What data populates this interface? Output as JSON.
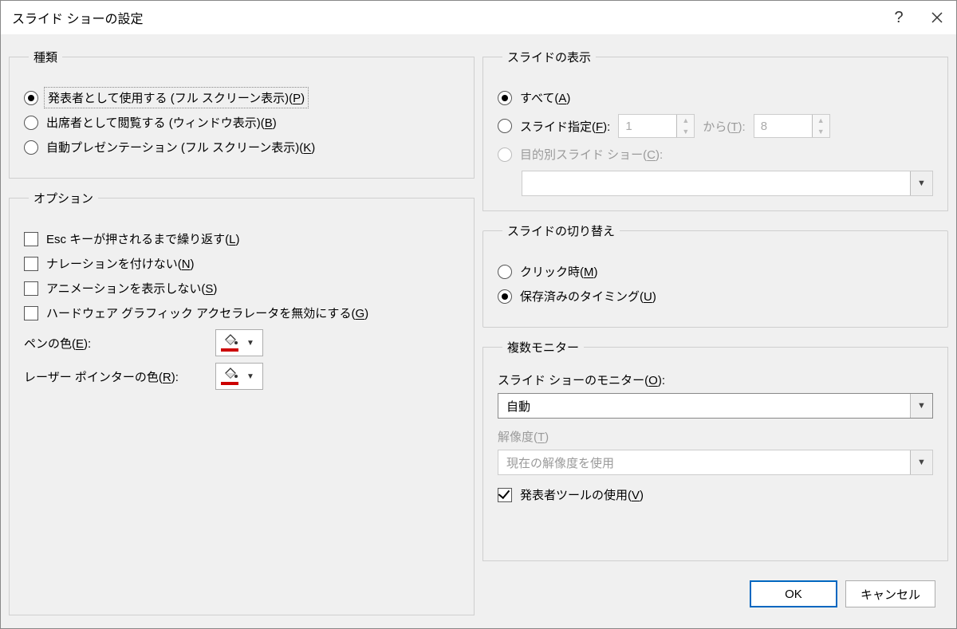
{
  "title": "スライド ショーの設定",
  "groups": {
    "type": {
      "legend": "種類",
      "opt_presenter": "発表者として使用する (フル スクリーン表示)(",
      "opt_presenter_key": "P",
      "opt_browse": "出席者として閲覧する (ウィンドウ表示)(",
      "opt_browse_key": "B",
      "opt_kiosk": "自動プレゼンテーション (フル スクリーン表示)(",
      "opt_kiosk_key": "K",
      "close_paren": ")"
    },
    "options": {
      "legend": "オプション",
      "loop": "Esc キーが押されるまで繰り返す(",
      "loop_key": "L",
      "nonarr": "ナレーションを付けない(",
      "nonarr_key": "N",
      "noanim": "アニメーションを表示しない(",
      "noanim_key": "S",
      "nohw": "ハードウェア グラフィック アクセラレータを無効にする(",
      "nohw_key": "G",
      "pencolor_label": "ペンの色(",
      "pencolor_key": "E",
      "lasercolor_label": "レーザー ポインターの色(",
      "lasercolor_key": "R",
      "close_paren": ")",
      "colon": ":"
    },
    "show_slides": {
      "legend": "スライドの表示",
      "all": "すべて(",
      "all_key": "A",
      "range": "スライド指定(",
      "range_key": "F",
      "from_val": "1",
      "to_label": "から(",
      "to_key": "T",
      "to_val": "8",
      "custom": "目的別スライド ショー(",
      "custom_key": "C",
      "close_paren": ")",
      "colon": ":"
    },
    "advance": {
      "legend": "スライドの切り替え",
      "manual": "クリック時(",
      "manual_key": "M",
      "timings": "保存済みのタイミング(",
      "timings_key": "U",
      "close_paren": ")"
    },
    "monitors": {
      "legend": "複数モニター",
      "monitor_label": "スライド ショーのモニター(",
      "monitor_key": "O",
      "monitor_val": "自動",
      "resolution_label": "解像度(",
      "resolution_key": "T",
      "resolution_val": "現在の解像度を使用",
      "presenter_view": "発表者ツールの使用(",
      "presenter_view_key": "V",
      "close_paren": ")",
      "colon": ":"
    }
  },
  "buttons": {
    "ok": "OK",
    "cancel": "キャンセル"
  }
}
